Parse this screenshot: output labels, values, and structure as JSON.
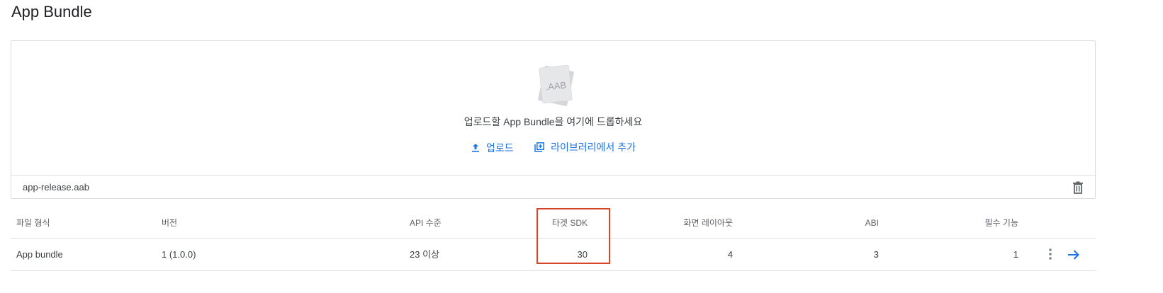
{
  "page": {
    "title": "App Bundle"
  },
  "upload": {
    "icon_text": ".AAB",
    "drop_text": "업로드할 App Bundle을 여기에 드롭하세요",
    "upload_label": "업로드",
    "library_label": "라이브러리에서 추가",
    "file_name": "app-release.aab"
  },
  "table": {
    "headers": [
      "파일 형식",
      "버전",
      "API 수준",
      "타겟 SDK",
      "화면 레이아웃",
      "ABI",
      "필수 기능"
    ],
    "rows": [
      [
        "App bundle",
        "1 (1.0.0)",
        "23 이상",
        "30",
        "4",
        "3",
        "1"
      ]
    ]
  },
  "colors": {
    "accent": "#1a73e8",
    "highlight": "#d9472b",
    "border": "#dadce0"
  }
}
